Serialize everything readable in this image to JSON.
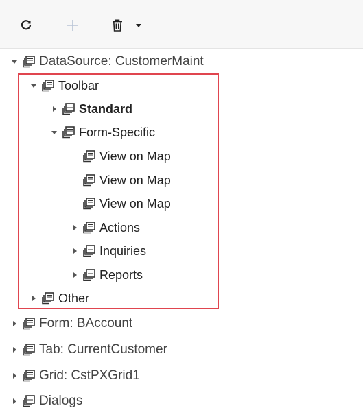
{
  "toolbar": {
    "refresh_icon": "refresh-icon",
    "add_icon": "plus-icon",
    "delete_icon": "trash-icon",
    "dropdown_icon": "caret-down-icon"
  },
  "tree": {
    "items": [
      {
        "label": "DataSource: CustomerMaint",
        "expanded": true
      },
      {
        "label": "Toolbar",
        "expanded": true
      },
      {
        "label": "Standard",
        "expanded": false
      },
      {
        "label": "Form-Specific",
        "expanded": true
      },
      {
        "label": "View on Map"
      },
      {
        "label": "View on Map"
      },
      {
        "label": "View on Map"
      },
      {
        "label": "Actions",
        "expanded": false
      },
      {
        "label": "Inquiries",
        "expanded": false
      },
      {
        "label": "Reports",
        "expanded": false
      },
      {
        "label": "Other",
        "expanded": false
      },
      {
        "label": "Form: BAccount",
        "expanded": false
      },
      {
        "label": "Tab: CurrentCustomer",
        "expanded": false
      },
      {
        "label": "Grid: CstPXGrid1",
        "expanded": false
      },
      {
        "label": "Dialogs",
        "expanded": false
      }
    ]
  },
  "colors": {
    "highlight_border": "#e0454f",
    "toolbar_bg": "#f7f7f7",
    "add_icon_disabled": "#b8c4d6"
  }
}
